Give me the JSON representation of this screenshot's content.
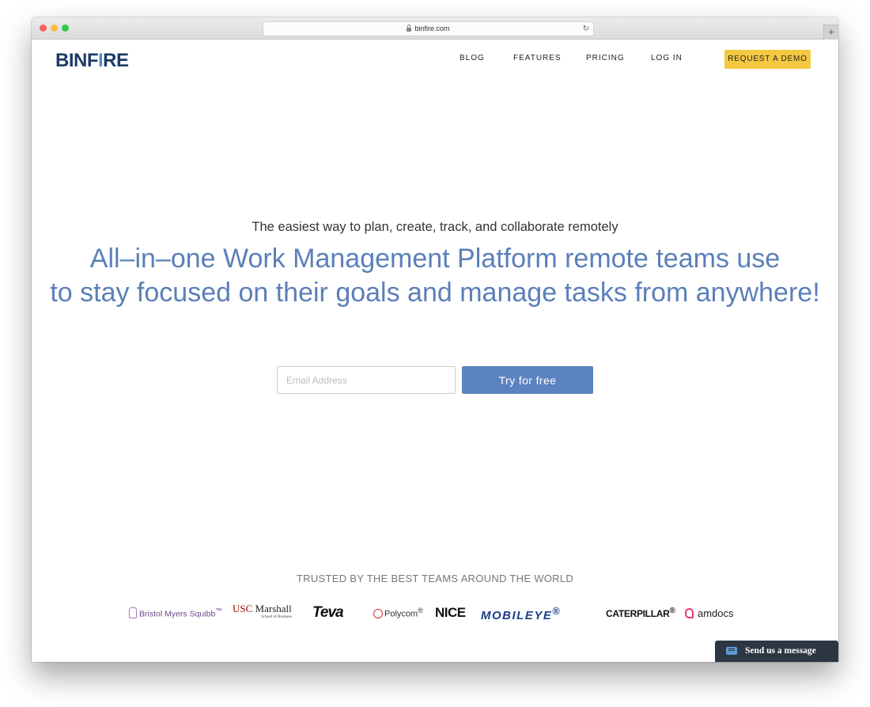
{
  "browser": {
    "url": "binfire.com",
    "new_tab_symbol": "+"
  },
  "header": {
    "logo_text_1": "BINF",
    "logo_flame": "I",
    "logo_text_2": "RE",
    "nav": {
      "blog": "BLOG",
      "features": "FEATURES",
      "pricing": "PRICING",
      "login": "LOG IN"
    },
    "demo_button": "REQUEST A DEMO"
  },
  "hero": {
    "tagline": "The easiest way to plan, create, track, and collaborate remotely",
    "headline_line1": "All–in–one Work Management Platform remote teams use",
    "headline_line2": "to stay focused on their goals and manage tasks from anywhere!"
  },
  "signup": {
    "email_placeholder": "Email Address",
    "email_value": "",
    "button_label": "Try for free"
  },
  "trusted": {
    "heading": "TRUSTED BY THE BEST TEAMS AROUND THE WORLD",
    "logos": {
      "bms": "Bristol Myers Squibb",
      "bms_tm": "™",
      "usc": "USC",
      "marshall": "Marshall",
      "marshall_sub": "School of Business",
      "teva": "Teva",
      "polycom": "Polycom",
      "polycom_tm": "®",
      "nice": "NICE",
      "mobileye": "MOBILEYE",
      "mobileye_tm": "®",
      "caterpillar": "CATERPILLAR",
      "caterpillar_tm": "®",
      "amdocs": "amdocs"
    }
  },
  "chat": {
    "label": "Send us a message"
  },
  "colors": {
    "accent_blue": "#5b83bf",
    "demo_yellow": "#f5c842",
    "logo_navy": "#1f3a66"
  }
}
